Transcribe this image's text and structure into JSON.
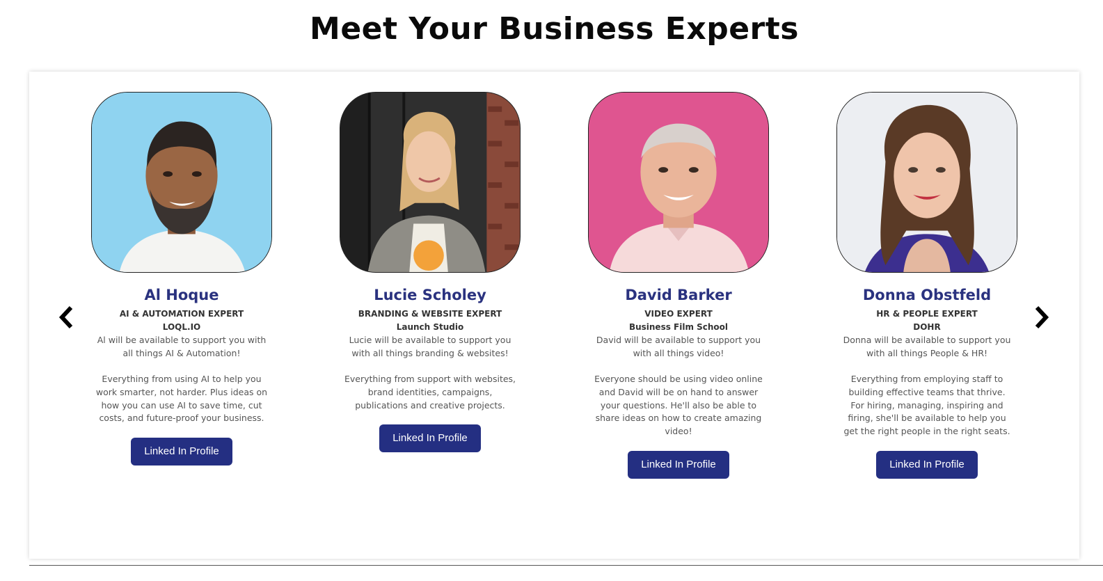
{
  "page": {
    "title": "Meet Your Business Experts"
  },
  "carousel": {
    "prev_icon": "chevron-left-icon",
    "next_icon": "chevron-right-icon"
  },
  "colors": {
    "accent": "#242f82",
    "name_color": "#2a327f"
  },
  "experts": [
    {
      "name": "Al Hoque",
      "role": "AI & AUTOMATION EXPERT",
      "company": "LOQL.IO",
      "intro": "Al will be available to support you with all things AI & Automation!",
      "details": "Everything from using AI to help you work smarter, not harder. Plus ideas on how you can use AI to save time, cut costs, and future-proof your business.",
      "button": "Linked In Profile",
      "photo_bg": "#8fd3f0"
    },
    {
      "name": "Lucie Scholey",
      "role": "BRANDING & WEBSITE EXPERT",
      "company": "Launch Studio",
      "intro": "Lucie will be available to support you with all things branding & websites!",
      "details": "Everything from support with websites, brand identities, campaigns, publications and creative projects.",
      "button": "Linked In Profile",
      "photo_bg": "#3a3a3a"
    },
    {
      "name": "David Barker",
      "role": "VIDEO EXPERT",
      "company": "Business Film School",
      "intro": "David will be available to support you with all things video!",
      "details": "Everyone should be using video online and David will be on hand to answer your questions. He'll also be able to share ideas on how to create amazing video!",
      "button": "Linked In Profile",
      "photo_bg": "#e0558f"
    },
    {
      "name": "Donna Obstfeld",
      "role": "HR & PEOPLE EXPERT",
      "company": "DOHR",
      "intro": "Donna will be available to support you with all things People & HR!",
      "details": "Everything from employing staff to building effective teams that thrive. For hiring, managing, inspiring and firing, she'll be available to help you get the right people in the right seats.",
      "button": "Linked In Profile",
      "photo_bg": "#eef0f4"
    }
  ]
}
